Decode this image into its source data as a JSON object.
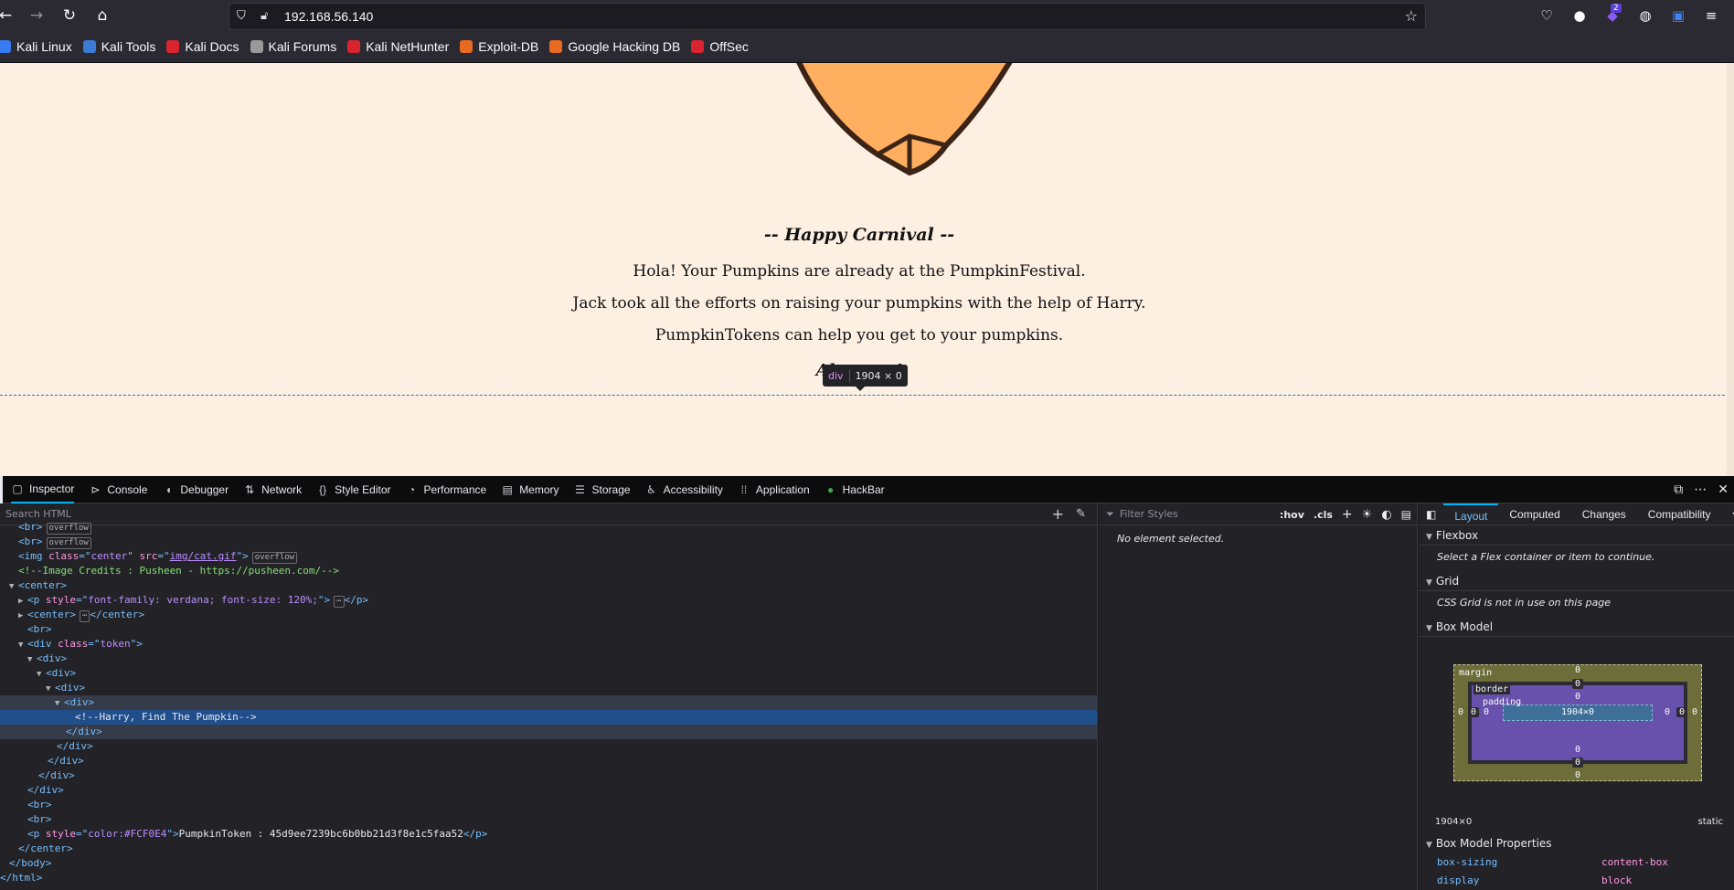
{
  "browser": {
    "url": "192.168.56.140",
    "toolbar_badge": "2",
    "bookmarks": [
      {
        "label": "Kali Linux",
        "color": "#367bf0"
      },
      {
        "label": "Kali Tools",
        "color": "#3a7bd5"
      },
      {
        "label": "Kali Docs",
        "color": "#d9232e"
      },
      {
        "label": "Kali Forums",
        "color": "#9a9a9a"
      },
      {
        "label": "Kali NetHunter",
        "color": "#d9232e"
      },
      {
        "label": "Exploit-DB",
        "color": "#e66a1f"
      },
      {
        "label": "Google Hacking DB",
        "color": "#e66a1f"
      },
      {
        "label": "OffSec",
        "color": "#d9232e"
      }
    ]
  },
  "page": {
    "heading": "-- Happy Carnival --",
    "lines": [
      "Hola! Your Pumpkins are already at the PumpkinFestival.",
      "Jack took all the efforts on raising your pumpkins with the help of Harry.",
      "PumpkinTokens can help you get to your pumpkins."
    ],
    "closing_visible": "Al",
    "closing_tail": "!",
    "node_tooltip": {
      "tag": "div",
      "dims": "1904 × 0"
    }
  },
  "devtools": {
    "tabs": [
      {
        "label": "Inspector",
        "icon": "inspector-icon",
        "active": true
      },
      {
        "label": "Console",
        "icon": "console-icon"
      },
      {
        "label": "Debugger",
        "icon": "debugger-icon"
      },
      {
        "label": "Network",
        "icon": "network-icon"
      },
      {
        "label": "Style Editor",
        "icon": "style-editor-icon"
      },
      {
        "label": "Performance",
        "icon": "performance-icon"
      },
      {
        "label": "Memory",
        "icon": "memory-icon"
      },
      {
        "label": "Storage",
        "icon": "storage-icon"
      },
      {
        "label": "Accessibility",
        "icon": "accessibility-icon"
      },
      {
        "label": "Application",
        "icon": "application-icon"
      },
      {
        "label": "HackBar",
        "icon": "hackbar-icon"
      }
    ],
    "markup": {
      "search_placeholder": "Search HTML",
      "badge_overflow": "overflow",
      "img_src": "img/cat.gif",
      "comment_credits": "<!--Image Credits : Pusheen - https://pusheen.com/-->",
      "p_style": "font-family: verdana; font-size: 120%;",
      "token_class": "token",
      "harry_comment": "<!--Harry, Find The Pumpkin-->",
      "token_p_style": "color:#FCF0E4",
      "token_text": "PumpkinToken : 45d9ee7239bc6b0bb21d3f8e1c5faa52"
    },
    "rules": {
      "filter_placeholder": "Filter Styles",
      "hov": ":hov",
      "cls": ".cls",
      "empty": "No element selected."
    },
    "layout": {
      "tabs": [
        "Layout",
        "Computed",
        "Changes",
        "Compatibility"
      ],
      "flexbox_title": "Flexbox",
      "flexbox_msg": "Select a Flex container or item to continue.",
      "grid_title": "Grid",
      "grid_msg": "CSS Grid is not in use on this page",
      "boxmodel_title": "Box Model",
      "labels": {
        "margin": "margin",
        "border": "border",
        "padding": "padding"
      },
      "content_size": "1904×0",
      "zero": "0",
      "footer_size": "1904×0",
      "footer_position": "static",
      "props_title": "Box Model Properties",
      "props": [
        {
          "name": "box-sizing",
          "value": "content-box"
        },
        {
          "name": "display",
          "value": "block"
        }
      ]
    }
  }
}
